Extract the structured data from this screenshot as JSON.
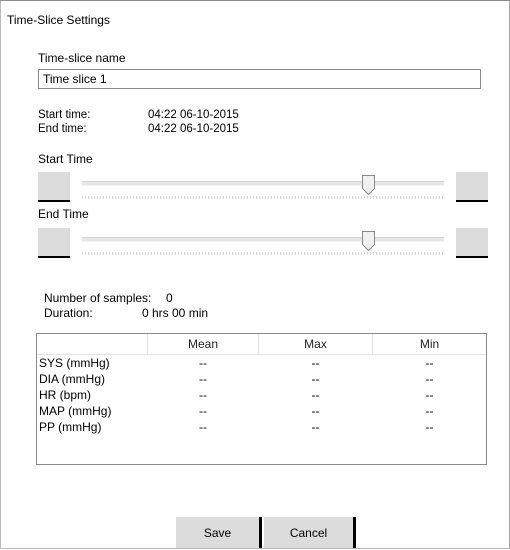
{
  "dialog": {
    "title": "Time-Slice Settings"
  },
  "name_section": {
    "label": "Time-slice name",
    "value": "Time slice 1"
  },
  "times": {
    "start_label": "Start time:",
    "start_value": "04:22 06-10-2015",
    "end_label": "End time:",
    "end_value": "04:22 06-10-2015"
  },
  "start_slider": {
    "label": "Start Time",
    "position_fraction": 0.79
  },
  "end_slider": {
    "label": "End Time",
    "position_fraction": 0.79
  },
  "summary": {
    "samples_label": "Number of samples:",
    "samples_value": "0",
    "duration_label": "Duration:",
    "duration_value": "0 hrs 00 min"
  },
  "stats_table": {
    "columns": [
      "",
      "Mean",
      "Max",
      "Min"
    ],
    "rows": [
      {
        "label": "SYS (mmHg)",
        "mean": "--",
        "max": "--",
        "min": "--"
      },
      {
        "label": "DIA (mmHg)",
        "mean": "--",
        "max": "--",
        "min": "--"
      },
      {
        "label": "HR (bpm)",
        "mean": "--",
        "max": "--",
        "min": "--"
      },
      {
        "label": "MAP (mmHg)",
        "mean": "--",
        "max": "--",
        "min": "--"
      },
      {
        "label": "PP (mmHg)",
        "mean": "--",
        "max": "--",
        "min": "--"
      }
    ]
  },
  "actions": {
    "save_label": "Save",
    "cancel_label": "Cancel"
  }
}
